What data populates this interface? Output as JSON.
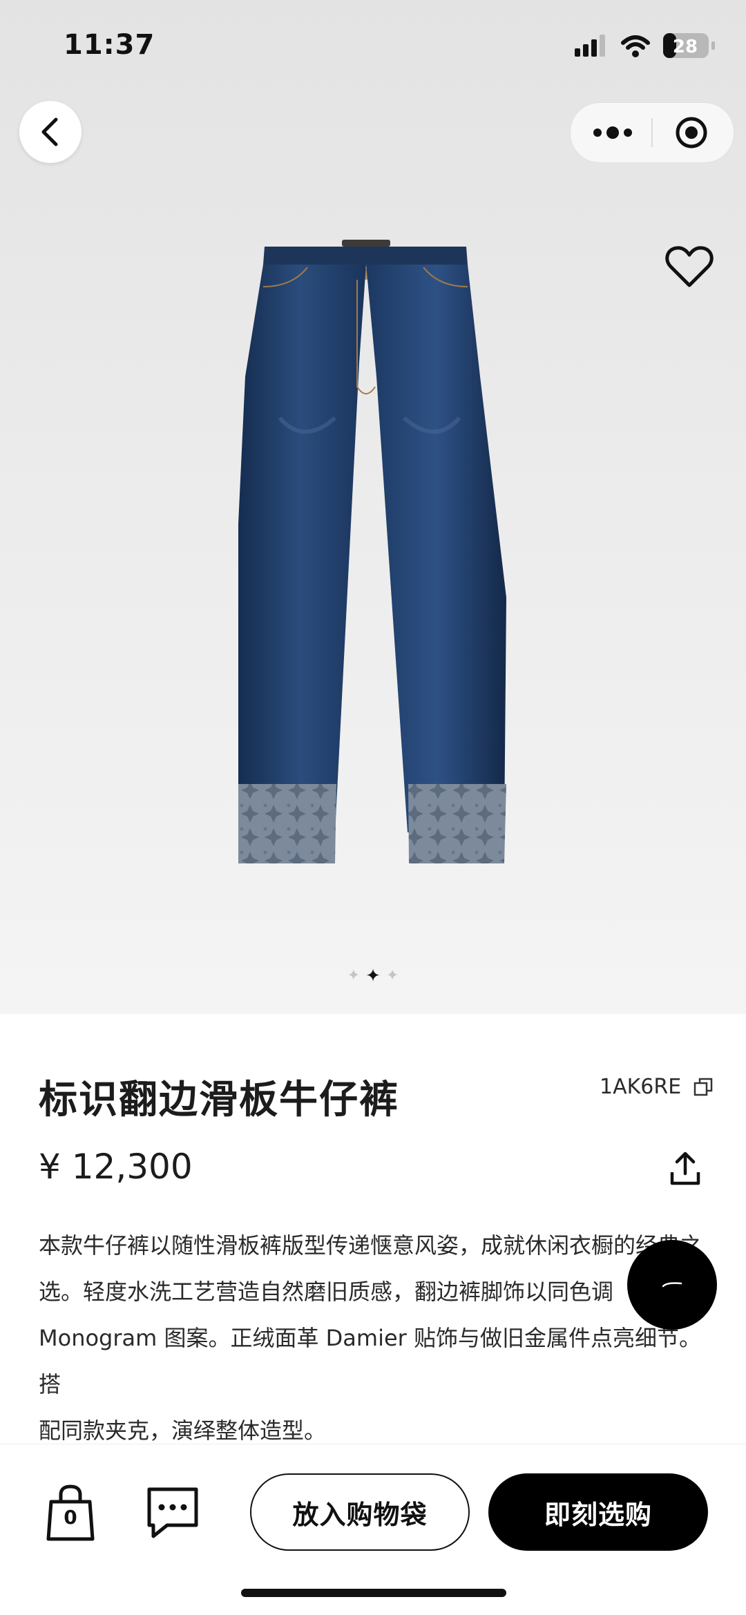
{
  "status_bar": {
    "time": "11:37",
    "battery": "28",
    "icons": [
      "signal-icon",
      "wifi-icon",
      "battery-icon"
    ]
  },
  "nav": {
    "back_icon": "chevron-left-icon",
    "menu_icon": "more-dots-icon",
    "close_icon": "target-close-icon"
  },
  "product": {
    "title": "标识翻边滑板牛仔裤",
    "sku": "1AK6RE",
    "price": "¥ 12,300",
    "description_lines": [
      "本款牛仔裤以随性滑板裤版型传递惬意风姿，成就休闲衣橱的经典之",
      "选。轻度水洗工艺营造自然磨旧质感，翻边裤脚饰以同色调",
      "Monogram 图案。正绒面革 Damier 贴饰与做旧金属件点亮细节。搭",
      "配同款夹克，演绎整体造型。"
    ],
    "image_count": 3,
    "active_image_index": 1
  },
  "actions": {
    "bag_count": "0",
    "add_to_bag": "放入购物袋",
    "buy_now": "即刻选购"
  },
  "colors": {
    "accent": "#000000",
    "background": "#ffffff",
    "hero_bg": "#ebebeb",
    "denim": "#1f3a63"
  }
}
